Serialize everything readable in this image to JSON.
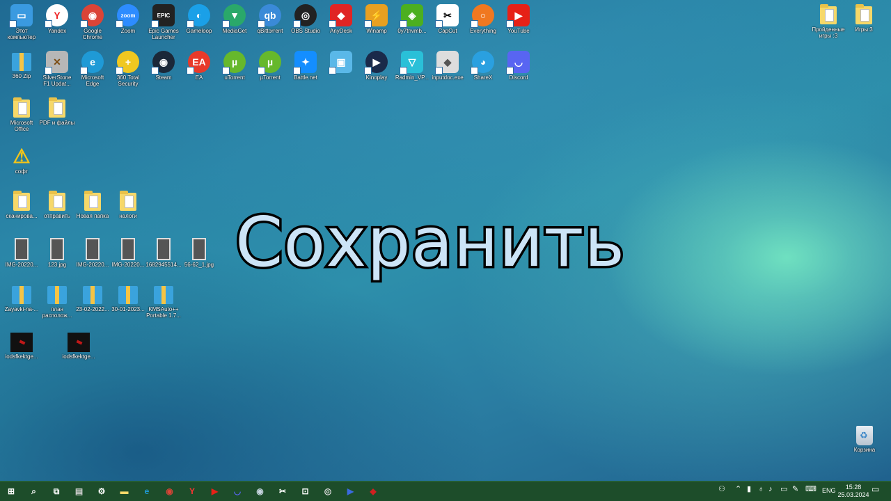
{
  "desktop": {
    "row1": [
      {
        "label": "Этот компьютер",
        "icon": "computer-icon",
        "color": "#3a9ae0",
        "glyph": "▭"
      },
      {
        "label": "Yandex",
        "icon": "yandex-browser-icon",
        "color": "#ffffff",
        "glyph": "Y",
        "fg": "#e22",
        "round": true
      },
      {
        "label": "Google Chrome",
        "icon": "chrome-icon",
        "color": "#db4437",
        "glyph": "◉",
        "round": true
      },
      {
        "label": "Zoom",
        "icon": "zoom-icon",
        "color": "#2d8cff",
        "glyph": "zoom",
        "round": true
      },
      {
        "label": "Epic Games Launcher",
        "icon": "epic-games-icon",
        "color": "#222222",
        "glyph": "EPIC"
      },
      {
        "label": "Gameloop",
        "icon": "gameloop-icon",
        "color": "#1aa0e8",
        "glyph": "◐",
        "round": true
      },
      {
        "label": "MediaGet",
        "icon": "mediaget-icon",
        "color": "#2aa86a",
        "glyph": "▼",
        "round": true
      },
      {
        "label": "qBittorrent",
        "icon": "qbittorrent-icon",
        "color": "#3a8ad8",
        "glyph": "qb",
        "round": true
      },
      {
        "label": "OBS Studio",
        "icon": "obs-icon",
        "color": "#222222",
        "glyph": "◎",
        "round": true
      },
      {
        "label": "AnyDesk",
        "icon": "anydesk-icon",
        "color": "#e02424",
        "glyph": "◆"
      },
      {
        "label": "Winamp",
        "icon": "winamp-icon",
        "color": "#e8a020",
        "glyph": "⚡"
      },
      {
        "label": "0y7tnvmb...",
        "icon": "game-shield-icon",
        "color": "#4caf20",
        "glyph": "◈"
      },
      {
        "label": "CapCut",
        "icon": "capcut-icon",
        "color": "#ffffff",
        "glyph": "✂",
        "fg": "#000"
      },
      {
        "label": "Everything",
        "icon": "everything-search-icon",
        "color": "#f07820",
        "glyph": "○",
        "round": true
      },
      {
        "label": "YouTube",
        "icon": "youtube-icon",
        "color": "#e62117",
        "glyph": "▶"
      }
    ],
    "row2": [
      {
        "label": "360 Zip",
        "icon": "archive-icon",
        "type": "archive"
      },
      {
        "label": "SilverStone F1 Updat...",
        "icon": "tools-icon",
        "color": "#b7b7b7",
        "glyph": "✕",
        "fg": "#7a4a10"
      },
      {
        "label": "Microsoft Edge",
        "icon": "edge-icon",
        "color": "#1f9ad6",
        "glyph": "e",
        "round": true
      },
      {
        "label": "360 Total Security",
        "icon": "total-security-icon",
        "color": "#f0c820",
        "glyph": "+",
        "round": true
      },
      {
        "label": "Steam",
        "icon": "steam-icon",
        "color": "#1b2838",
        "glyph": "◉",
        "round": true
      },
      {
        "label": "EA",
        "icon": "ea-icon",
        "color": "#e83a2a",
        "glyph": "EA",
        "round": true
      },
      {
        "label": "uTorrent",
        "icon": "utorrent-icon",
        "color": "#66b82c",
        "glyph": "µ",
        "round": true
      },
      {
        "label": "µTorrent",
        "icon": "utorrent-icon",
        "color": "#66b82c",
        "glyph": "µ",
        "round": true
      },
      {
        "label": "Battle.net",
        "icon": "battlenet-icon",
        "color": "#148eff",
        "glyph": "✦"
      },
      {
        "label": "",
        "icon": "app-window-icon",
        "color": "#5ab8e8",
        "glyph": "▣"
      },
      {
        "label": "Kinoplay",
        "icon": "kinoplay-icon",
        "color": "#1a2a4a",
        "glyph": "▶",
        "round": true
      },
      {
        "label": "Radmin_VP...",
        "icon": "radmin-icon",
        "color": "#2ac0d8",
        "glyph": "▽"
      },
      {
        "label": "inputdoc.exe",
        "icon": "installer-icon",
        "color": "#dddddd",
        "glyph": "◆",
        "fg": "#555"
      },
      {
        "label": "ShareX",
        "icon": "sharex-icon",
        "color": "#2aa0e0",
        "glyph": "◕",
        "round": true
      },
      {
        "label": "Discord",
        "icon": "discord-icon",
        "color": "#5865f2",
        "glyph": "◡"
      }
    ],
    "row3": [
      {
        "label": "Microsoft Office",
        "icon": "folder-icon",
        "type": "folder"
      },
      {
        "label": "PDF и файлы",
        "icon": "folder-icon",
        "type": "folder"
      }
    ],
    "row4": [
      {
        "label": "софт",
        "icon": "warning-icon",
        "type": "warning"
      }
    ],
    "row5": [
      {
        "label": "сканирова...",
        "icon": "folder-icon",
        "type": "folder"
      },
      {
        "label": "отправить",
        "icon": "folder-icon",
        "type": "folder"
      },
      {
        "label": "Новая папка",
        "icon": "folder-icon",
        "type": "folder"
      },
      {
        "label": "налоги",
        "icon": "folder-icon",
        "type": "folder"
      }
    ],
    "row6": [
      {
        "label": "IMG-20220...",
        "icon": "image-file-icon",
        "type": "photo"
      },
      {
        "label": "123.jpg",
        "icon": "image-file-icon",
        "type": "photo"
      },
      {
        "label": "IMG-20220...",
        "icon": "image-file-icon",
        "type": "photo"
      },
      {
        "label": "IMG-20220...",
        "icon": "image-file-icon",
        "type": "photo"
      },
      {
        "label": "1682945514...",
        "icon": "image-file-icon",
        "type": "photo"
      },
      {
        "label": "56-62_1.jpg",
        "icon": "image-file-icon",
        "type": "photo"
      }
    ],
    "row7": [
      {
        "label": "Zayavki-na-...",
        "icon": "archive-icon",
        "type": "archive"
      },
      {
        "label": "план располож...",
        "icon": "archive-icon",
        "type": "archive"
      },
      {
        "label": "23-02-2022...",
        "icon": "archive-icon",
        "type": "archive"
      },
      {
        "label": "30-01-2023...",
        "icon": "archive-icon",
        "type": "archive"
      },
      {
        "label": "KMSAuto++ Portable 1.7...",
        "icon": "archive-icon",
        "type": "archive"
      }
    ],
    "row8": [
      {
        "label": "iodsfkektge...",
        "icon": "image-file-icon",
        "type": "dark"
      },
      {
        "label": "iodsfkektge...",
        "icon": "image-file-icon",
        "type": "dark"
      }
    ],
    "right": [
      {
        "label": "Пройденные игры :3",
        "icon": "folder-icon",
        "type": "folder"
      },
      {
        "label": "Игры:3",
        "icon": "folder-icon",
        "type": "folder"
      }
    ],
    "recycle_bin": {
      "label": "Корзина",
      "icon": "recycle-bin-icon"
    }
  },
  "overlay": {
    "text": "Сохранить"
  },
  "taskbar": {
    "apps": [
      {
        "name": "start-icon",
        "glyph": "⊞",
        "color": "#ffffff"
      },
      {
        "name": "search-icon",
        "glyph": "⌕",
        "color": "#ffffff"
      },
      {
        "name": "task-view-icon",
        "glyph": "⧉",
        "color": "#ffffff"
      },
      {
        "name": "explorer-icon",
        "glyph": "▤",
        "color": "#cfcfcf"
      },
      {
        "name": "settings-icon",
        "glyph": "⚙",
        "color": "#ffffff"
      },
      {
        "name": "folder-icon",
        "glyph": "▬",
        "color": "#f6d869"
      },
      {
        "name": "edge-icon",
        "glyph": "e",
        "color": "#1f9ad6"
      },
      {
        "name": "chrome-icon",
        "glyph": "◉",
        "color": "#db4437"
      },
      {
        "name": "yandex-browser-icon",
        "glyph": "Y",
        "color": "#ff3333"
      },
      {
        "name": "youtube-icon",
        "glyph": "▶",
        "color": "#e62117"
      },
      {
        "name": "discord-icon",
        "glyph": "◡",
        "color": "#5865f2"
      },
      {
        "name": "steam-icon",
        "glyph": "◉",
        "color": "#c7d5e0"
      },
      {
        "name": "capcut-icon",
        "glyph": "✂",
        "color": "#ffffff"
      },
      {
        "name": "store-icon",
        "glyph": "⊡",
        "color": "#ffffff"
      },
      {
        "name": "obs-icon",
        "glyph": "◎",
        "color": "#dddddd"
      },
      {
        "name": "kinoplay-icon",
        "glyph": "▶",
        "color": "#3a6adf"
      },
      {
        "name": "game-icon",
        "glyph": "◆",
        "color": "#d02020"
      }
    ],
    "tray": {
      "language": "ENG",
      "time": "15:28",
      "date": "25.03.2024"
    }
  }
}
